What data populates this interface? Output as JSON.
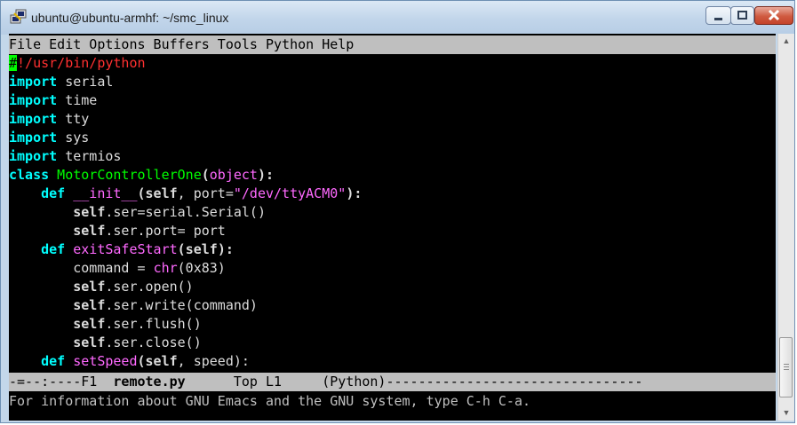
{
  "window": {
    "title": "ubuntu@ubuntu-armhf: ~/smc_linux",
    "app_icon": "putty-icon"
  },
  "menubar": "File Edit Options Buffers Tools Python Help",
  "code": {
    "l1_cursor": "#",
    "l1_rest": "!/usr/bin/python",
    "l2_kw": "import",
    "l2_rest": " serial",
    "l3_kw": "import",
    "l3_rest": " time",
    "l4_kw": "import",
    "l4_rest": " tty",
    "l5_kw": "import",
    "l5_rest": " sys",
    "l6_kw": "import",
    "l6_rest": " termios",
    "l7_kw": "class",
    "l7_name": " MotorControllerOne",
    "l7_p1": "(",
    "l7_base": "object",
    "l7_p2": "):",
    "l8_indent": "    ",
    "l8_kw": "def",
    "l8_name": " __init__",
    "l8_p1": "(",
    "l8_self": "self",
    "l8_mid": ", port=",
    "l8_str": "\"/dev/ttyACM0\"",
    "l8_end": "):",
    "l9_indent": "        ",
    "l9_self": "self",
    "l9_rest": ".ser=serial.Serial()",
    "l10_indent": "        ",
    "l10_self": "self",
    "l10_rest": ".ser.port= port",
    "l11_indent": "    ",
    "l11_kw": "def",
    "l11_name": " exitSafeStart",
    "l11_p1": "(",
    "l11_self": "self",
    "l11_end": "):",
    "l12_indent": "        ",
    "l12_rest": "command = ",
    "l12_fn": "chr",
    "l12_arg": "(0x83)",
    "l13_indent": "        ",
    "l13_self": "self",
    "l13_rest": ".ser.open()",
    "l14_indent": "        ",
    "l14_self": "self",
    "l14_rest": ".ser.write(command)",
    "l15_indent": "        ",
    "l15_self": "self",
    "l15_rest": ".ser.flush()",
    "l16_indent": "        ",
    "l16_self": "self",
    "l16_rest": ".ser.close()",
    "l17_indent": "    ",
    "l17_kw": "def",
    "l17_name": " setSpeed",
    "l17_p1": "(",
    "l17_self": "self",
    "l17_end": ", speed):"
  },
  "modeline": {
    "prefix": "-=--:----F1  ",
    "buffer": "remote.py",
    "middle": "      Top L1     (Python)",
    "fill": "--------------------------------"
  },
  "echo_area": "For information about GNU Emacs and the GNU system, type C-h C-a.",
  "colors": {
    "terminal_bg": "#000000",
    "keyword": "#00ffff",
    "string": "#ff69ff",
    "shebang": "#ff3030",
    "class_def_name": "#00ff00",
    "cursor": "#00ff00",
    "bar_bg": "#bfbfbf"
  }
}
